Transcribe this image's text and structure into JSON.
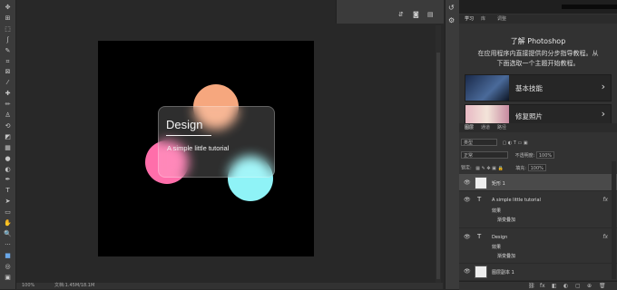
{
  "toolbar": {
    "tools": [
      "move-icon",
      "artboard-icon",
      "marquee-icon",
      "lasso-icon",
      "quick-select-icon",
      "crop-icon",
      "frame-icon",
      "eyedropper-icon",
      "healing-icon",
      "brush-icon",
      "stamp-icon",
      "history-brush-icon",
      "eraser-icon",
      "gradient-icon",
      "blur-icon",
      "dodge-icon",
      "pen-icon",
      "type-icon",
      "path-select-icon",
      "rectangle-icon",
      "hand-icon",
      "zoom-icon",
      "more-icon",
      "color-swatch",
      "quick-mask-icon",
      "screen-mode-icon"
    ],
    "glyphs": [
      "✥",
      "⊞",
      "⬚",
      "ʃ",
      "✎",
      "⌗",
      "⊠",
      "⁄",
      "✚",
      "✏",
      "♙",
      "⟲",
      "◩",
      "▦",
      "●",
      "◐",
      "✒",
      "T",
      "➤",
      "▭",
      "✋",
      "🔍",
      "···",
      "■",
      "◎",
      "▣"
    ]
  },
  "document": {
    "title": "Design",
    "subtitle": "A simple little tutorial",
    "colors": {
      "orange": "#f6a77e",
      "pink": "#ff6eaa",
      "cyan": "#8ff3f7"
    }
  },
  "statusbar": {
    "zoom": "100%",
    "info": "文档:1.45M/18.1M"
  },
  "right_panel": {
    "tabs": [
      "学习",
      "库",
      "调整"
    ],
    "learn": {
      "title": "了解 Photoshop",
      "desc_line1": "在应用程序内直接提供的分步指导教程。从",
      "desc_line2": "下面选取一个主题开始教程。",
      "cards": [
        {
          "label": "基本技能",
          "arrow": "›"
        },
        {
          "label": "修复照片",
          "arrow": "›"
        }
      ]
    },
    "layers_tabs": [
      "图层",
      "通道",
      "路径"
    ],
    "filter": {
      "kind": "类型"
    },
    "blend": {
      "mode": "正常",
      "opacity_label": "不透明度:",
      "opacity": "100%"
    },
    "lock": {
      "label": "锁定:",
      "fill_label": "填充:",
      "fill": "100%"
    },
    "layers": [
      {
        "name": "矩形 1",
        "type": "shape"
      },
      {
        "name": "A simple little tutorial",
        "type": "text",
        "effects_label": "效果",
        "effect": "渐变叠加",
        "fx": "fx"
      },
      {
        "name": "Design",
        "type": "text",
        "effects_label": "效果",
        "effect": "渐变叠加",
        "fx": "fx"
      },
      {
        "name": "图层副本 1",
        "type": "image"
      }
    ],
    "bottom_icons": [
      "⛓",
      "fx",
      "◧",
      "◐",
      "▢",
      "⊕",
      "🗑"
    ]
  }
}
